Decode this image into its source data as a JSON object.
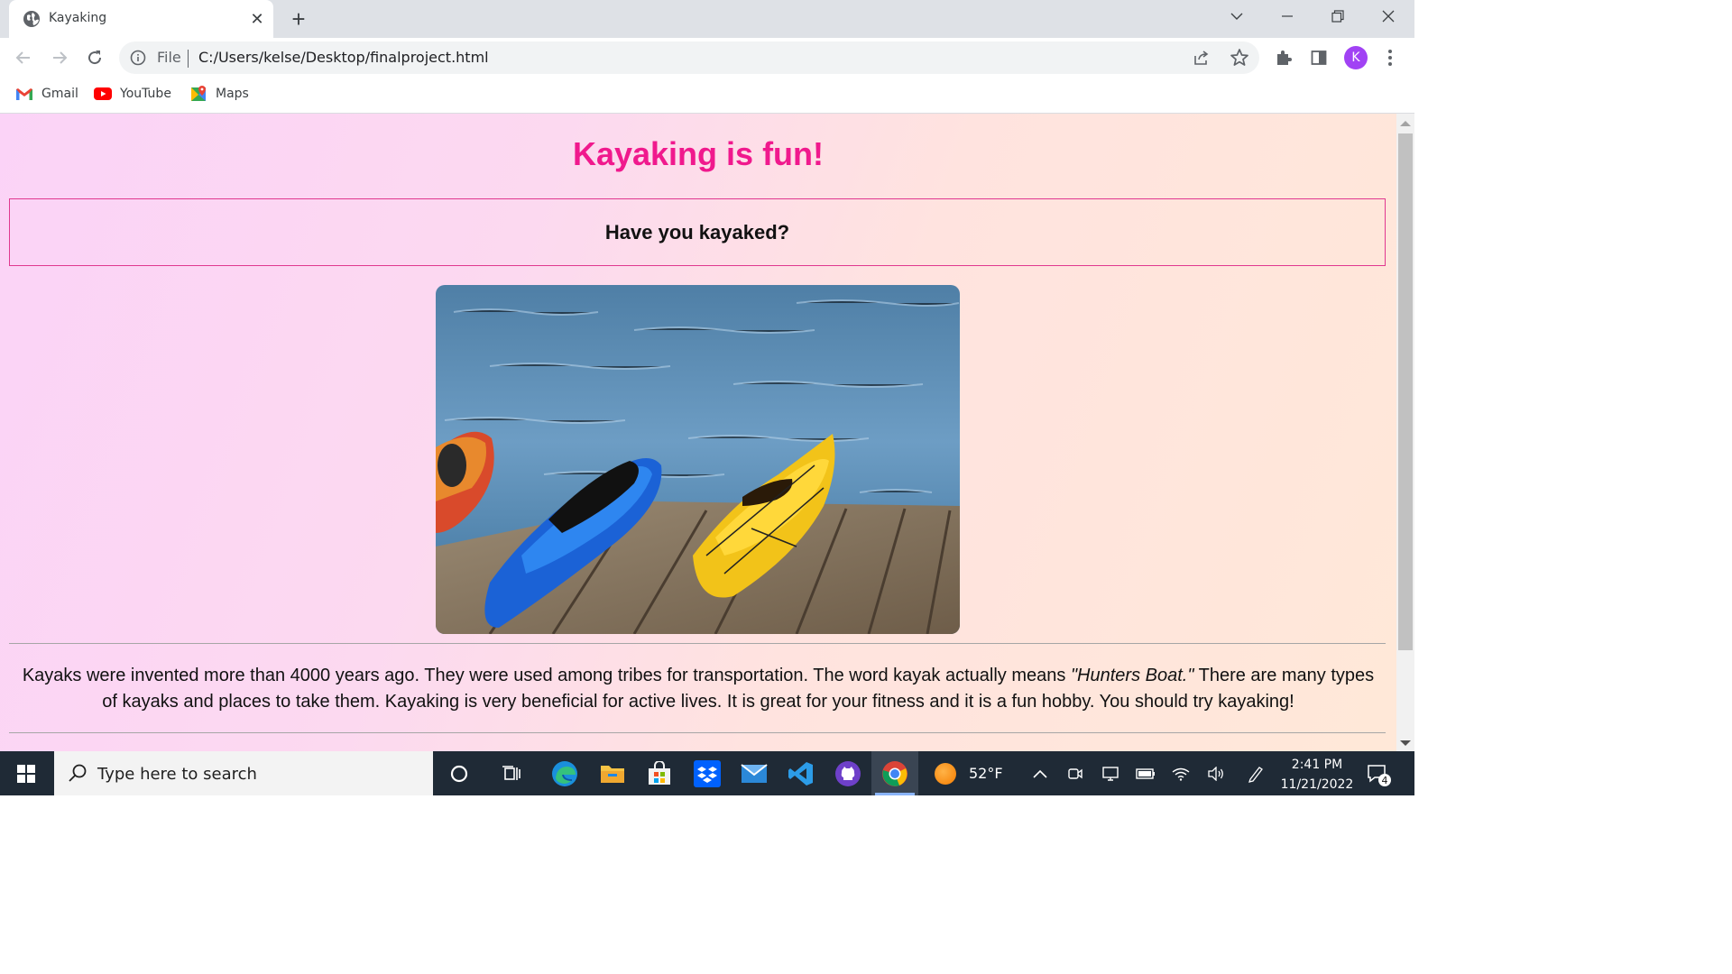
{
  "browser": {
    "tab_title": "Kayaking",
    "scheme_label": "File",
    "url": "C:/Users/kelse/Desktop/finalproject.html",
    "profile_initial": "K",
    "bookmarks": [
      "Gmail",
      "YouTube",
      "Maps"
    ]
  },
  "page": {
    "title": "Kayaking is fun!",
    "question": "Have you kayaked?",
    "paragraph_part1": "Kayaks were invented more than 4000 years ago. They were used among tribes for transportation. The word kayak actually means ",
    "paragraph_em": "\"Hunters Boat.\"",
    "paragraph_part2": " There are many types of kayaks and places to take them. Kayaking is very beneficial for active lives. It is great for your fitness and it is a fun hobby. You should try kayaking!"
  },
  "taskbar": {
    "search_placeholder": "Type here to search",
    "weather": "52°F",
    "time": "2:41 PM",
    "date": "11/21/2022",
    "notification_count": "4"
  },
  "colors": {
    "title_pink": "#f0198d",
    "box_border": "#e0388f",
    "bg_left": "#fbd3f7",
    "bg_right": "#ffe8d8"
  }
}
